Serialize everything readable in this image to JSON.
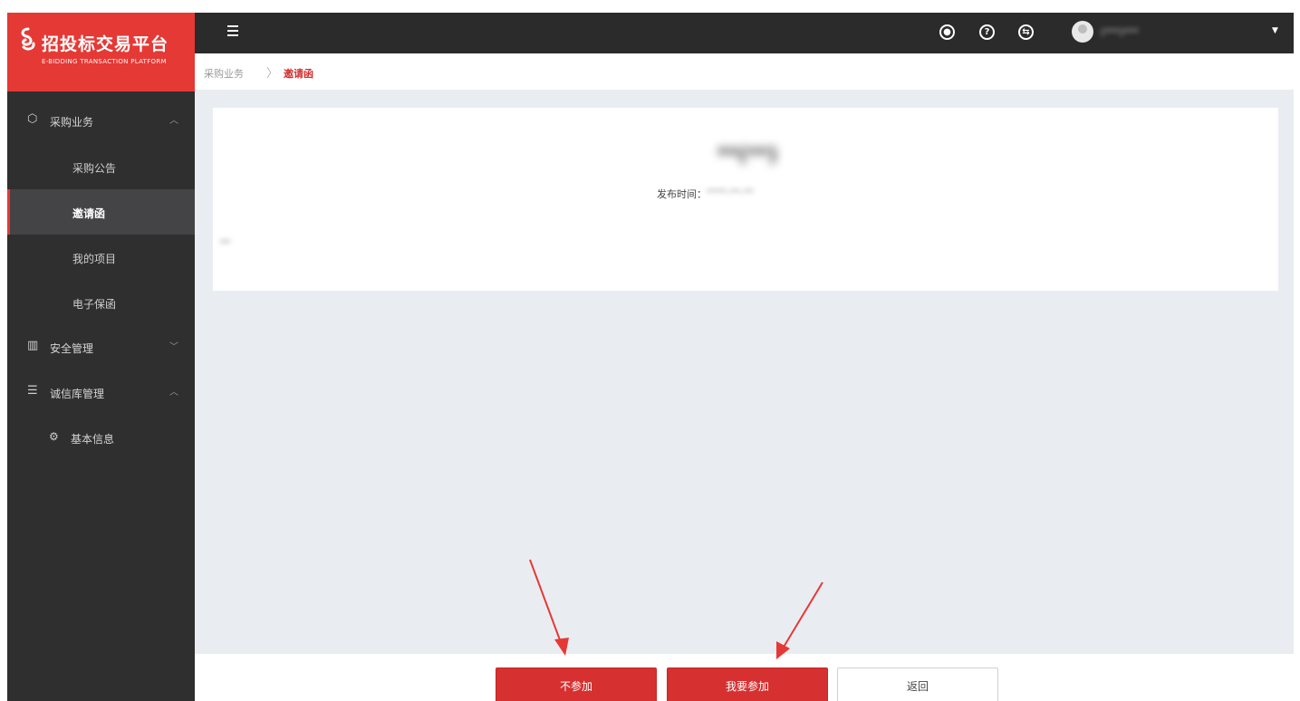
{
  "app": {
    "logo_title": "招投标交易平台",
    "logo_subtitle": "E-BIDDING TRANSACTION PLATFORM"
  },
  "sidebar": {
    "groups": [
      {
        "label": "采购业务",
        "icon": "cube-icon",
        "expanded": true,
        "items": [
          {
            "label": "采购公告",
            "active": false
          },
          {
            "label": "邀请函",
            "active": true
          },
          {
            "label": "我的项目",
            "active": false
          },
          {
            "label": "电子保函",
            "active": false
          }
        ]
      },
      {
        "label": "安全管理",
        "icon": "building-icon",
        "expanded": false
      },
      {
        "label": "诚信库管理",
        "icon": "list-icon",
        "expanded": true,
        "items": [
          {
            "label": "基本信息",
            "icon": "gear-icon"
          }
        ]
      }
    ]
  },
  "topbar": {
    "icons": [
      "notification-icon",
      "help-icon",
      "switch-icon"
    ],
    "username": "(***)***"
  },
  "breadcrumb": {
    "parent": "采购业务",
    "separator": ">",
    "current": "邀请函"
  },
  "document": {
    "title": "**(**)",
    "publish_label": "发布时间：",
    "publish_value": "****-**-**",
    "note": "**"
  },
  "footer": {
    "decline_label": "不参加",
    "join_label": "我要参加",
    "back_label": "返回"
  },
  "colors": {
    "brand": "#e53935",
    "sidebar_bg": "#2f2f30",
    "topbar_bg": "#2b2b2b",
    "content_bg": "#e9edf2",
    "primary_button": "#d63030"
  }
}
